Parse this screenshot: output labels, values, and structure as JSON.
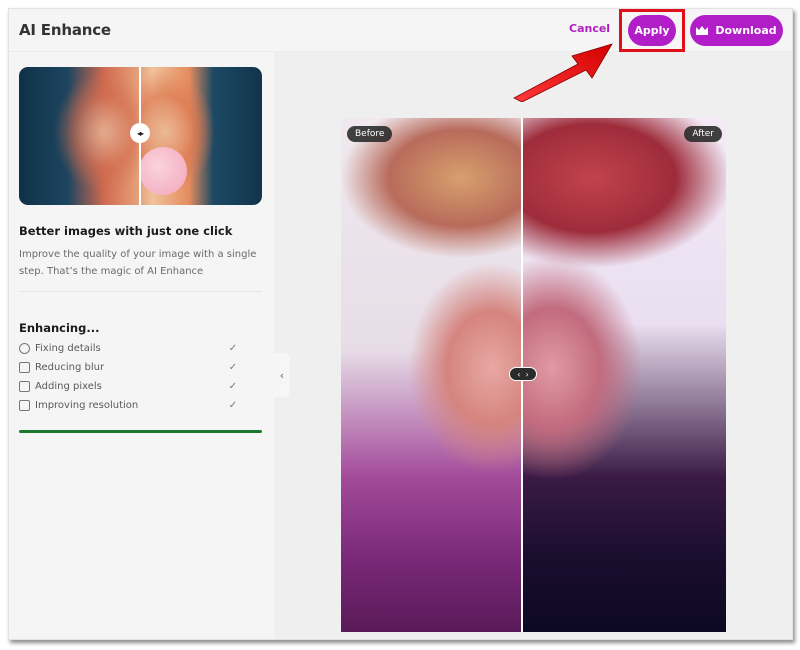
{
  "header": {
    "title": "AI Enhance",
    "cancel_label": "Cancel",
    "apply_label": "Apply",
    "download_label": "Download",
    "accent_color": "#b11ec7"
  },
  "sidebar": {
    "promo_title": "Better images with just one click",
    "promo_description": "Improve the quality of your image with a single step. That’s the magic of AI Enhance",
    "status_title": "Enhancing...",
    "steps": [
      {
        "icon": "face-icon",
        "label": "Fixing details",
        "done": "✓"
      },
      {
        "icon": "grid-icon",
        "label": "Reducing blur",
        "done": "✓"
      },
      {
        "icon": "pixels-icon",
        "label": "Adding pixels",
        "done": "✓"
      },
      {
        "icon": "resolution-icon",
        "label": "Improving resolution",
        "done": "✓"
      }
    ],
    "progress_percent": 100,
    "progress_color": "#1b7a2f",
    "thumbnail_handle": "◂▸",
    "collapse_glyph": "‹"
  },
  "preview": {
    "before_label": "Before",
    "after_label": "After",
    "handle_left": "‹",
    "handle_right": "›"
  },
  "annotation": {
    "highlight_color": "#e0101a",
    "highlights": "apply-button"
  }
}
